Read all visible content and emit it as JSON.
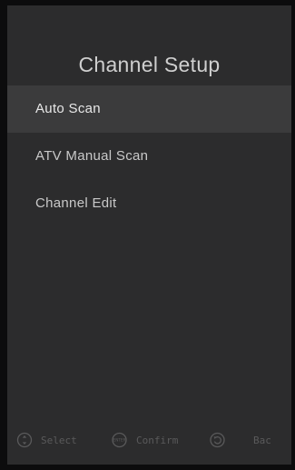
{
  "title": "Channel Setup",
  "menu": {
    "items": [
      {
        "label": "Auto Scan",
        "selected": true
      },
      {
        "label": "ATV Manual Scan",
        "selected": false
      },
      {
        "label": "Channel Edit",
        "selected": false
      }
    ]
  },
  "footer": {
    "select": {
      "label": "Select",
      "icon": "dpad-icon"
    },
    "confirm": {
      "label": "Confirm",
      "icon": "enter-icon",
      "icon_text": "ENTER"
    },
    "back": {
      "label": "Bac",
      "icon": "back-arrow-icon"
    }
  },
  "colors": {
    "background": "#2c2c2d",
    "selected_row": "#3b3b3c",
    "text": "#c9c9c9",
    "hint": "#5a5a5b"
  }
}
